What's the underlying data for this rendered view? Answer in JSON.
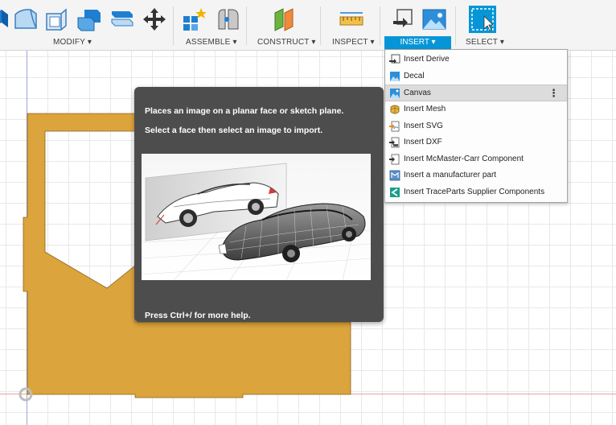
{
  "toolbar": {
    "groups": [
      {
        "label": "MODIFY ▾"
      },
      {
        "label": "ASSEMBLE ▾"
      },
      {
        "label": "CONSTRUCT ▾"
      },
      {
        "label": "INSPECT ▾"
      },
      {
        "label": "INSERT ▾"
      },
      {
        "label": "SELECT ▾"
      }
    ],
    "accent": "#0696d7"
  },
  "insert_menu": {
    "items": [
      {
        "label": "Insert Derive",
        "icon": "insert-derive-icon"
      },
      {
        "label": "Decal",
        "icon": "decal-icon"
      },
      {
        "label": "Canvas",
        "icon": "canvas-icon",
        "more": "⋮"
      },
      {
        "label": "Insert Mesh",
        "icon": "insert-mesh-icon"
      },
      {
        "label": "Insert SVG",
        "icon": "insert-svg-icon"
      },
      {
        "label": "Insert DXF",
        "icon": "insert-dxf-icon"
      },
      {
        "label": "Insert McMaster-Carr Component",
        "icon": "mcmaster-carr-icon"
      },
      {
        "label": "Insert a manufacturer part",
        "icon": "manufacturer-part-icon"
      },
      {
        "label": "Insert TraceParts Supplier Components",
        "icon": "traceparts-icon"
      }
    ],
    "active_index": 2
  },
  "tooltip": {
    "line1": "Places an image on a planar face or sketch plane.",
    "line2": "Select a face then select an image to import.",
    "footer": "Press Ctrl+/ for more help."
  },
  "colors": {
    "sketch_fill": "#dba43c",
    "tooltip_bg": "#4d4d4d",
    "menu_highlight": "#dcdcdc"
  }
}
